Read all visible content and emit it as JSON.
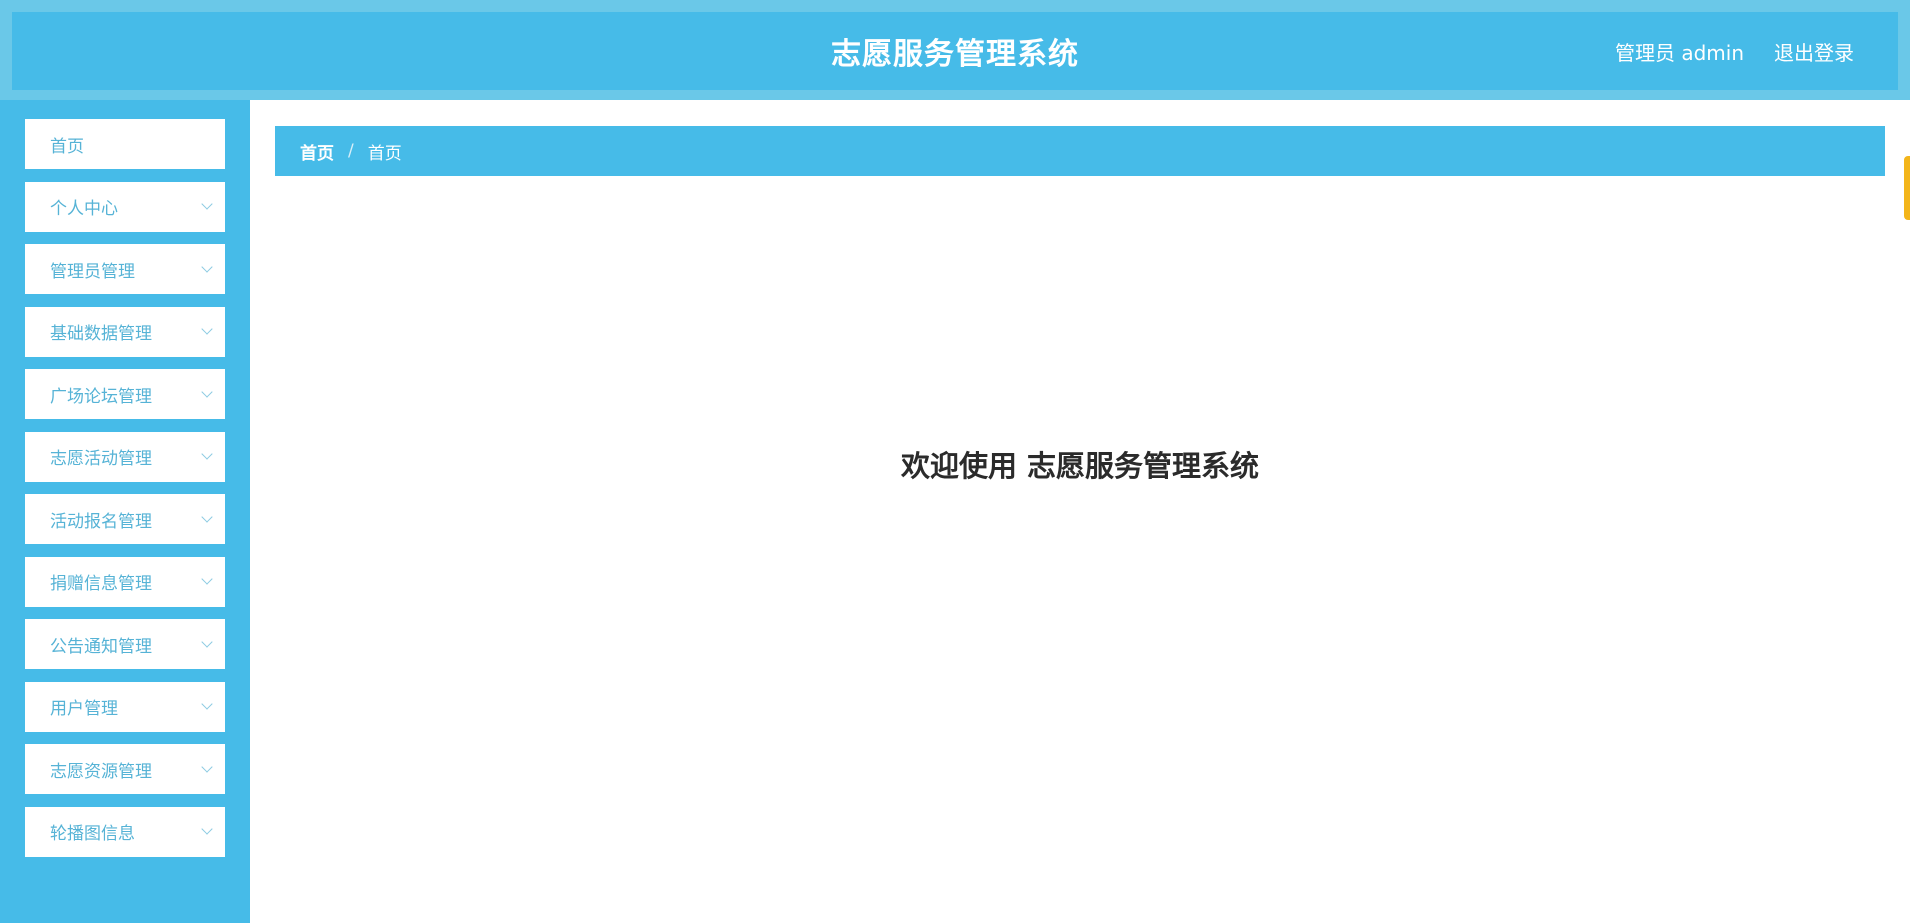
{
  "header": {
    "title": "志愿服务管理系统",
    "user_label": "管理员 admin",
    "logout_label": "退出登录"
  },
  "sidebar": {
    "items": [
      {
        "label": "首页",
        "has_submenu": false
      },
      {
        "label": "个人中心",
        "has_submenu": true
      },
      {
        "label": "管理员管理",
        "has_submenu": true
      },
      {
        "label": "基础数据管理",
        "has_submenu": true
      },
      {
        "label": "广场论坛管理",
        "has_submenu": true
      },
      {
        "label": "志愿活动管理",
        "has_submenu": true
      },
      {
        "label": "活动报名管理",
        "has_submenu": true
      },
      {
        "label": "捐赠信息管理",
        "has_submenu": true
      },
      {
        "label": "公告通知管理",
        "has_submenu": true
      },
      {
        "label": "用户管理",
        "has_submenu": true
      },
      {
        "label": "志愿资源管理",
        "has_submenu": true
      },
      {
        "label": "轮播图信息",
        "has_submenu": true
      }
    ]
  },
  "breadcrumb": {
    "root": "首页",
    "separator": "/",
    "current": "首页"
  },
  "main": {
    "welcome_text": "欢迎使用 志愿服务管理系统"
  },
  "colors": {
    "primary": "#46bbe8",
    "header_border": "#6ac8e8",
    "menu_text": "#56b3d6",
    "accent_tab": "#f3b51a"
  }
}
